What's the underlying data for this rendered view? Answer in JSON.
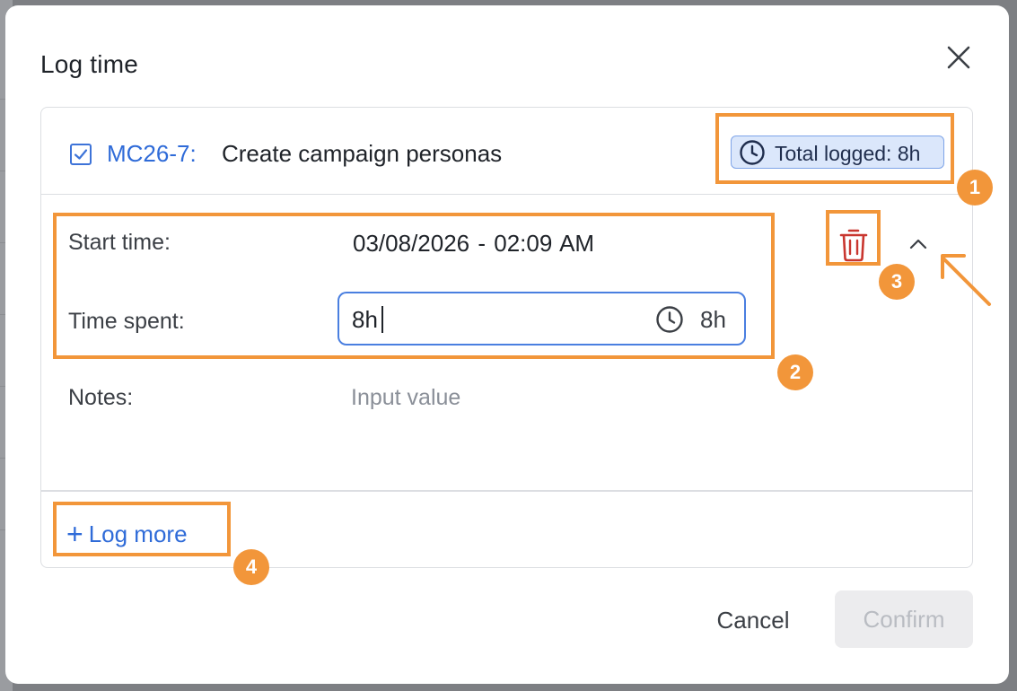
{
  "dialog": {
    "title": "Log time",
    "close_icon": "close-icon"
  },
  "task": {
    "key": "MC26-7:",
    "name": "Create campaign personas",
    "total_logged": "Total logged: 8h"
  },
  "entry": {
    "start_label": "Start time:",
    "start_value": "03/08/2026   - 02:09 AM",
    "time_spent_label": "Time spent:",
    "time_spent_value": "8h",
    "time_spent_suffix": "8h",
    "notes_label": "Notes:",
    "notes_placeholder": "Input value"
  },
  "actions": {
    "log_more_plus": "+",
    "log_more": "Log more",
    "cancel": "Cancel",
    "confirm": "Confirm"
  },
  "annotations": {
    "badges": [
      "1",
      "2",
      "3",
      "4"
    ],
    "color": "#f2963a"
  },
  "colors": {
    "link_blue": "#2f6bd8",
    "delete_red": "#c9362f",
    "focus_border": "#4a7fe0"
  }
}
